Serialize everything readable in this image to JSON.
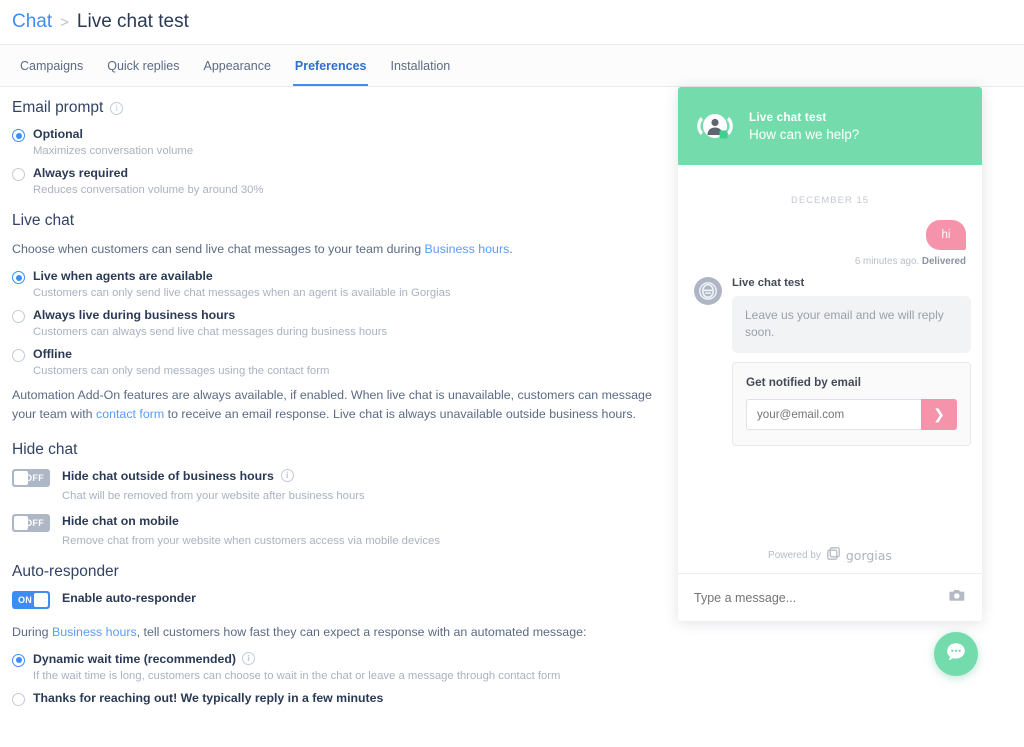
{
  "breadcrumb": {
    "root": "Chat",
    "separator": ">",
    "current": "Live chat test"
  },
  "tabs": [
    {
      "label": "Campaigns",
      "active": false
    },
    {
      "label": "Quick replies",
      "active": false
    },
    {
      "label": "Appearance",
      "active": false
    },
    {
      "label": "Preferences",
      "active": true
    },
    {
      "label": "Installation",
      "active": false
    }
  ],
  "email_prompt": {
    "title": "Email prompt",
    "info_icon": "info-icon",
    "options": [
      {
        "label": "Optional",
        "sub": "Maximizes conversation volume",
        "checked": true
      },
      {
        "label": "Always required",
        "sub": "Reduces conversation volume by around 30%",
        "checked": false
      }
    ]
  },
  "live_chat": {
    "title": "Live chat",
    "intro_before": "Choose when customers can send live chat messages to your team during ",
    "intro_link": "Business hours",
    "intro_after": ".",
    "options": [
      {
        "label": "Live when agents are available",
        "sub": "Customers can only send live chat messages when an agent is available in Gorgias",
        "checked": true
      },
      {
        "label": "Always live during business hours",
        "sub": "Customers can always send live chat messages during business hours",
        "checked": false
      },
      {
        "label": "Offline",
        "sub": "Customers can only send messages using the contact form",
        "checked": false
      }
    ],
    "note_before": "Automation Add-On features are always available, if enabled. When live chat is unavailable, customers can message your team with ",
    "note_link": "contact form",
    "note_after": " to receive an email response. Live chat is always unavailable outside business hours."
  },
  "hide_chat": {
    "title": "Hide chat",
    "toggles": [
      {
        "state": "OFF",
        "on": false,
        "label": "Hide chat outside of business hours",
        "info": true,
        "sub": "Chat will be removed from your website after business hours"
      },
      {
        "state": "OFF",
        "on": false,
        "label": "Hide chat on mobile",
        "info": false,
        "sub": "Remove chat from your website when customers access via mobile devices"
      }
    ]
  },
  "auto_responder": {
    "title": "Auto-responder",
    "toggle": {
      "state": "ON",
      "on": true,
      "label": "Enable auto-responder"
    },
    "intro_before": "During ",
    "intro_link": "Business hours",
    "intro_after": ", tell customers how fast they can expect a response with an automated message:",
    "options": [
      {
        "label": "Dynamic wait time (recommended)",
        "info": true,
        "sub": "If the wait time is long, customers can choose to wait in the chat or leave a message through contact form",
        "checked": true
      },
      {
        "label": "Thanks for reaching out! We typically reply in a few minutes",
        "info": false,
        "sub": "",
        "checked": false
      }
    ]
  },
  "widget": {
    "header": {
      "title": "Live chat test",
      "subtitle": "How can we help?",
      "color": "#74dbad",
      "avatar_icon": "agent-avatar-icon"
    },
    "date_divider": "DECEMBER 15",
    "user_message": {
      "text": "hi",
      "color": "#f593ab"
    },
    "message_meta": {
      "time": "6 minutes ago.",
      "status": "Delivered"
    },
    "agent_message": {
      "name": "Live chat test",
      "text": "Leave us your email and we will reply soon.",
      "avatar_icon": "gorgias-logo-icon"
    },
    "email_card": {
      "title": "Get notified by email",
      "placeholder": "your@email.com",
      "value": "",
      "send_icon": "chevron-right-icon"
    },
    "powered_by": {
      "text": "Powered by",
      "brand": "gorgias",
      "icon": "gorgias-mark-icon"
    },
    "composer": {
      "placeholder": "Type a message...",
      "camera_icon": "camera-icon"
    },
    "launcher": {
      "icon": "chat-bubble-icon",
      "color": "#74dbad"
    }
  }
}
